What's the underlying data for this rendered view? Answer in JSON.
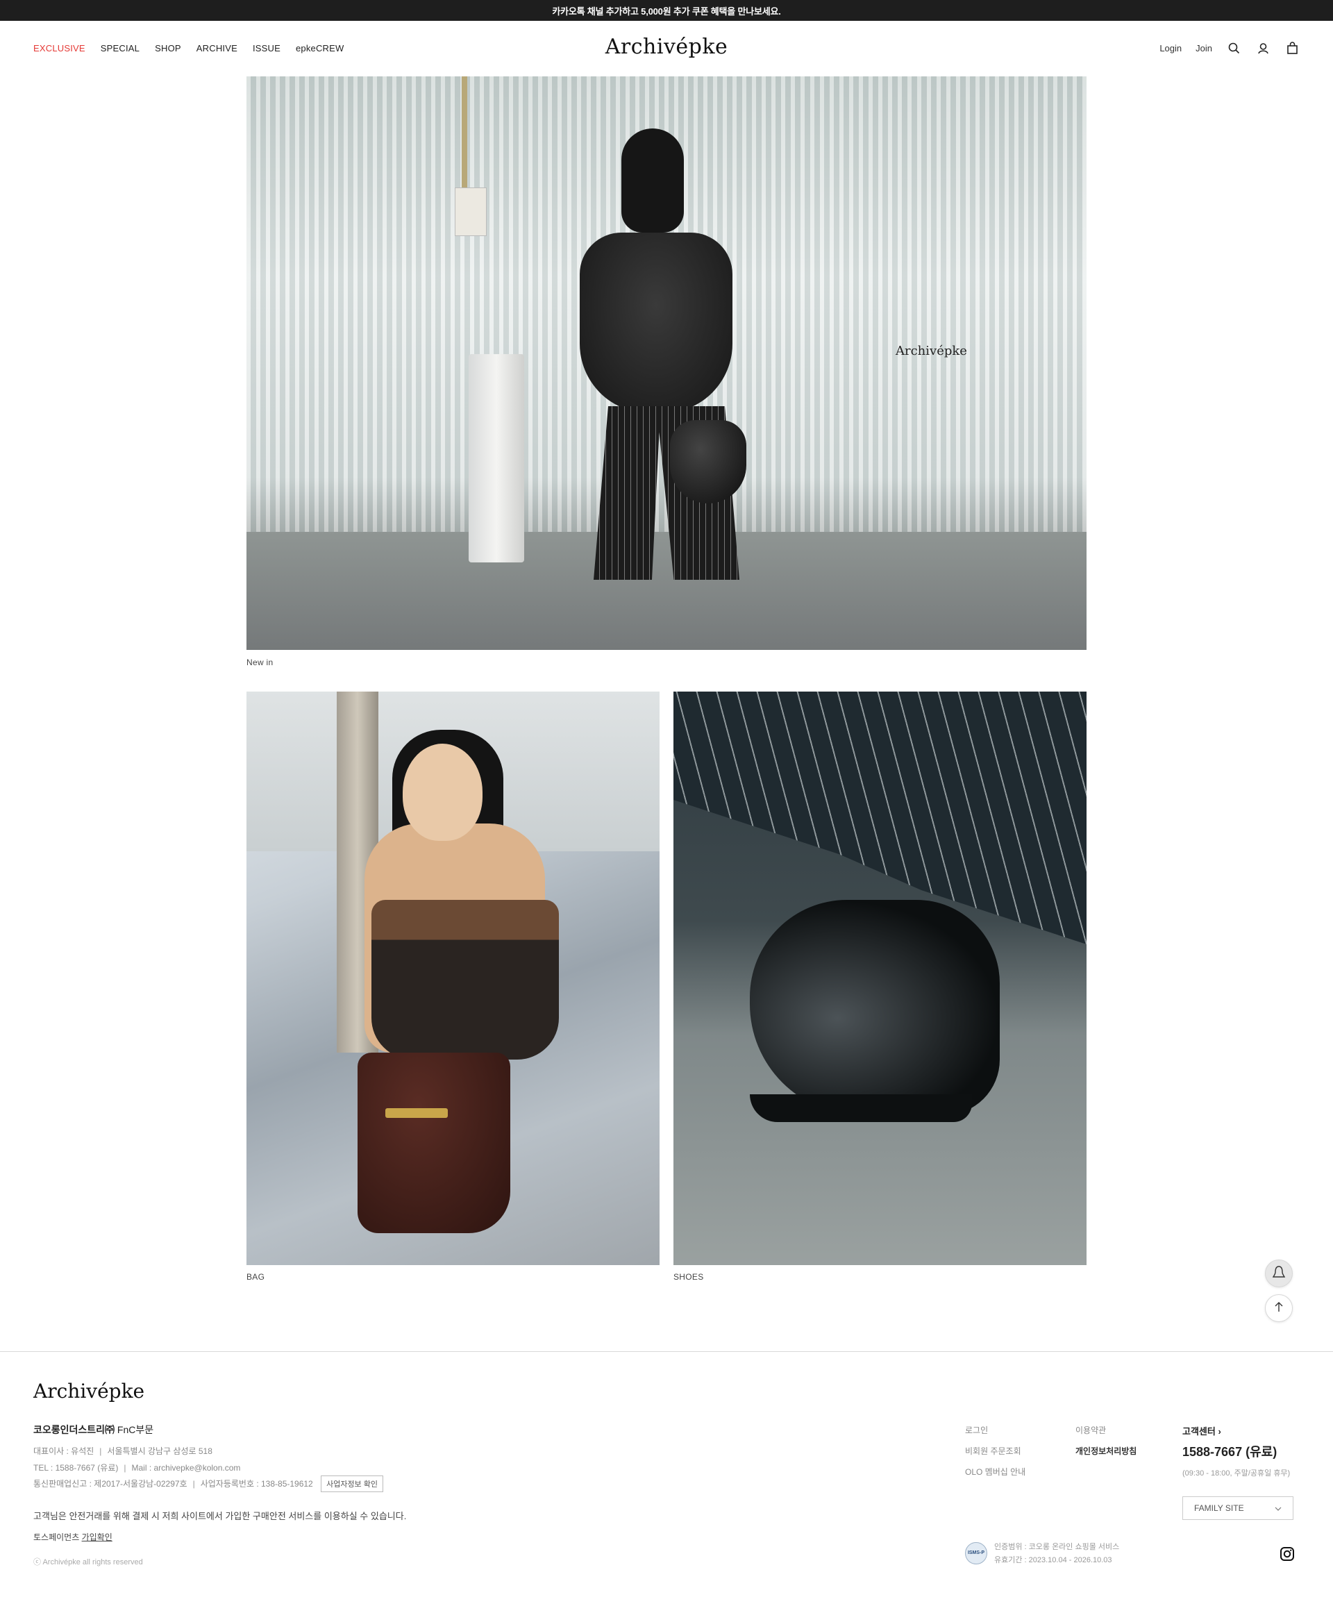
{
  "banner": {
    "text": "카카오톡 채널 추가하고 5,000원 추가 쿠폰 혜택을 만나보세요."
  },
  "header": {
    "logo": "Archivépke",
    "nav": [
      "EXCLUSIVE",
      "SPECIAL",
      "SHOP",
      "ARCHIVE",
      "ISSUE",
      "epkeCREW"
    ],
    "login": "Login",
    "join": "Join",
    "icons": [
      "search-icon",
      "user-icon",
      "bag-icon"
    ]
  },
  "main": {
    "hero_watermark": "Archivépke",
    "hero_caption": "New in",
    "left_caption": "BAG",
    "right_caption": "SHOES"
  },
  "floating": {
    "icons": [
      "kakao-talk-icon",
      "arrow-up-icon"
    ]
  },
  "footer": {
    "logo": "Archivépke",
    "company_bold": "코오롱인더스트리㈜",
    "company_rest": " FnC부문",
    "ceo_label": "대표이사 : 유석진",
    "address": "서울특별시 강남구 삼성로 518",
    "tel": "TEL : 1588-7667 (유료)",
    "mail": "Mail : archivepke@kolon.com",
    "mail_order": "통신판매업신고 : 제2017-서울강남-02297호",
    "biz_no": "사업자등록번호 : 138-85-19612",
    "biz_btn": "사업자정보 확인",
    "safe_notice": "고객님은 안전거래를 위해 결제 시 저희 사이트에서 가입한 구매안전 서비스를 이용하실 수 있습니다.",
    "toss_prefix": "토스페이먼츠 ",
    "toss_link": "가입확인",
    "copyright": "ⓒ Archivépke all rights reserved",
    "links_col1": [
      "로그인",
      "비회원 주문조회",
      "OLO 멤버십 안내"
    ],
    "links_col2": [
      "이용약관",
      "개인정보처리방침"
    ],
    "cs_title": "고객센터 ›",
    "cs_tel": "1588-7667 (유료)",
    "cs_hours": "(09:30 - 18:00, 주말/공휴일 휴무)",
    "family_site": "FAMILY SITE",
    "isms_badge": "ISMS-P",
    "isms_line1": "인증범위 : 코오롱 온라인 쇼핑몰 서비스",
    "isms_line2": "유효기간 : 2023.10.04 - 2026.10.03"
  },
  "colors": {
    "accent": "#e53935",
    "banner_bg": "#1e1e1e"
  }
}
